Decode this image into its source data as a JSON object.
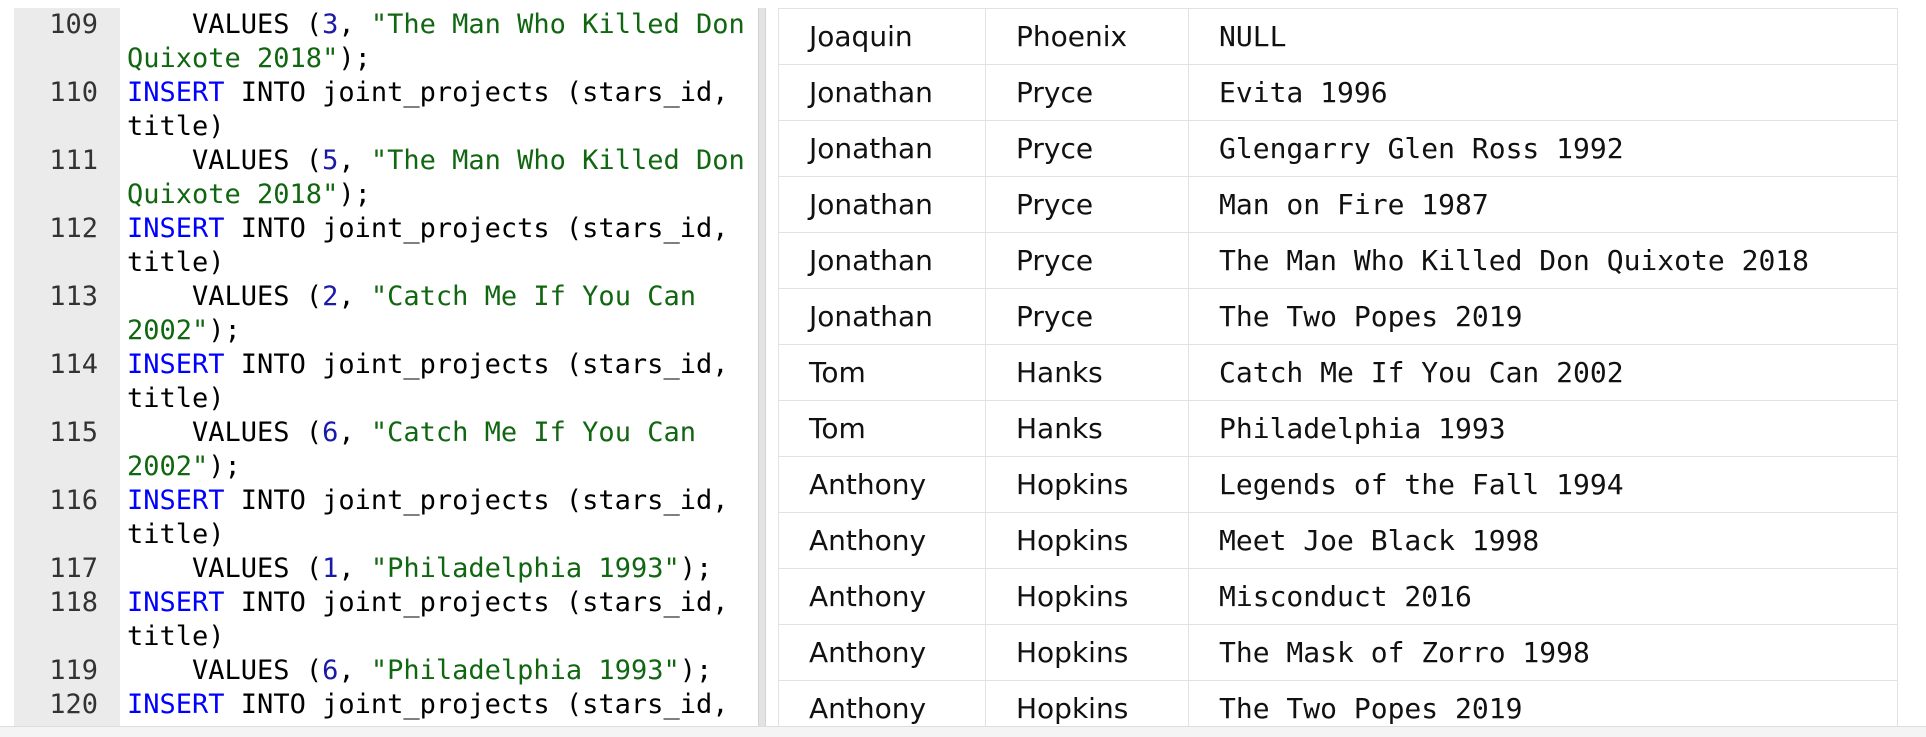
{
  "editor": {
    "lines": [
      {
        "no": "109",
        "parts": [
          {
            "t": "    VALUES (",
            "c": "plain"
          },
          {
            "t": "3",
            "c": "num"
          },
          {
            "t": ", ",
            "c": "plain"
          },
          {
            "t": "\"The Man Who Killed Don Quixote 2018\"",
            "c": "str"
          },
          {
            "t": ");",
            "c": "plain"
          }
        ]
      },
      {
        "no": "110",
        "parts": [
          {
            "t": "INSERT",
            "c": "kw"
          },
          {
            "t": " INTO joint_projects (stars_id, title)",
            "c": "plain"
          }
        ]
      },
      {
        "no": "111",
        "parts": [
          {
            "t": "    VALUES (",
            "c": "plain"
          },
          {
            "t": "5",
            "c": "num"
          },
          {
            "t": ", ",
            "c": "plain"
          },
          {
            "t": "\"The Man Who Killed Don Quixote 2018\"",
            "c": "str"
          },
          {
            "t": ");",
            "c": "plain"
          }
        ]
      },
      {
        "no": "112",
        "parts": [
          {
            "t": "INSERT",
            "c": "kw"
          },
          {
            "t": " INTO joint_projects (stars_id, title)",
            "c": "plain"
          }
        ]
      },
      {
        "no": "113",
        "parts": [
          {
            "t": "    VALUES (",
            "c": "plain"
          },
          {
            "t": "2",
            "c": "num"
          },
          {
            "t": ", ",
            "c": "plain"
          },
          {
            "t": "\"Catch Me If You Can 2002\"",
            "c": "str"
          },
          {
            "t": ");",
            "c": "plain"
          }
        ]
      },
      {
        "no": "114",
        "parts": [
          {
            "t": "INSERT",
            "c": "kw"
          },
          {
            "t": " INTO joint_projects (stars_id, title)",
            "c": "plain"
          }
        ]
      },
      {
        "no": "115",
        "parts": [
          {
            "t": "    VALUES (",
            "c": "plain"
          },
          {
            "t": "6",
            "c": "num"
          },
          {
            "t": ", ",
            "c": "plain"
          },
          {
            "t": "\"Catch Me If You Can 2002\"",
            "c": "str"
          },
          {
            "t": ");",
            "c": "plain"
          }
        ]
      },
      {
        "no": "116",
        "parts": [
          {
            "t": "INSERT",
            "c": "kw"
          },
          {
            "t": " INTO joint_projects (stars_id, title)",
            "c": "plain"
          }
        ]
      },
      {
        "no": "117",
        "parts": [
          {
            "t": "    VALUES (",
            "c": "plain"
          },
          {
            "t": "1",
            "c": "num"
          },
          {
            "t": ", ",
            "c": "plain"
          },
          {
            "t": "\"Philadelphia 1993\"",
            "c": "str"
          },
          {
            "t": ");",
            "c": "plain"
          }
        ]
      },
      {
        "no": "118",
        "parts": [
          {
            "t": "INSERT",
            "c": "kw"
          },
          {
            "t": " INTO joint_projects (stars_id, title)",
            "c": "plain"
          }
        ]
      },
      {
        "no": "119",
        "parts": [
          {
            "t": "    VALUES (",
            "c": "plain"
          },
          {
            "t": "6",
            "c": "num"
          },
          {
            "t": ", ",
            "c": "plain"
          },
          {
            "t": "\"Philadelphia 1993\"",
            "c": "str"
          },
          {
            "t": ");",
            "c": "plain"
          }
        ]
      },
      {
        "no": "120",
        "parts": [
          {
            "t": "INSERT",
            "c": "kw"
          },
          {
            "t": " INTO joint_projects (stars_id,",
            "c": "plain"
          }
        ]
      }
    ]
  },
  "results": {
    "rows": [
      [
        "Joaquin",
        "Phoenix",
        "NULL"
      ],
      [
        "Jonathan",
        "Pryce",
        "Evita 1996"
      ],
      [
        "Jonathan",
        "Pryce",
        "Glengarry Glen Ross 1992"
      ],
      [
        "Jonathan",
        "Pryce",
        "Man on Fire 1987"
      ],
      [
        "Jonathan",
        "Pryce",
        "The Man Who Killed Don Quixote 2018"
      ],
      [
        "Jonathan",
        "Pryce",
        "The Two Popes 2019"
      ],
      [
        "Tom",
        "Hanks",
        "Catch Me If You Can 2002"
      ],
      [
        "Tom",
        "Hanks",
        "Philadelphia 1993"
      ],
      [
        "Anthony",
        "Hopkins",
        "Legends of the Fall 1994"
      ],
      [
        "Anthony",
        "Hopkins",
        "Meet Joe Black 1998"
      ],
      [
        "Anthony",
        "Hopkins",
        "Misconduct 2016"
      ],
      [
        "Anthony",
        "Hopkins",
        "The Mask of Zorro 1998"
      ],
      [
        "Anthony",
        "Hopkins",
        "The Two Popes 2019"
      ]
    ]
  },
  "colors": {
    "keyword": "#0000ff",
    "number": "#1a1aa6",
    "string": "#116611",
    "gutter": "#ebebeb"
  }
}
